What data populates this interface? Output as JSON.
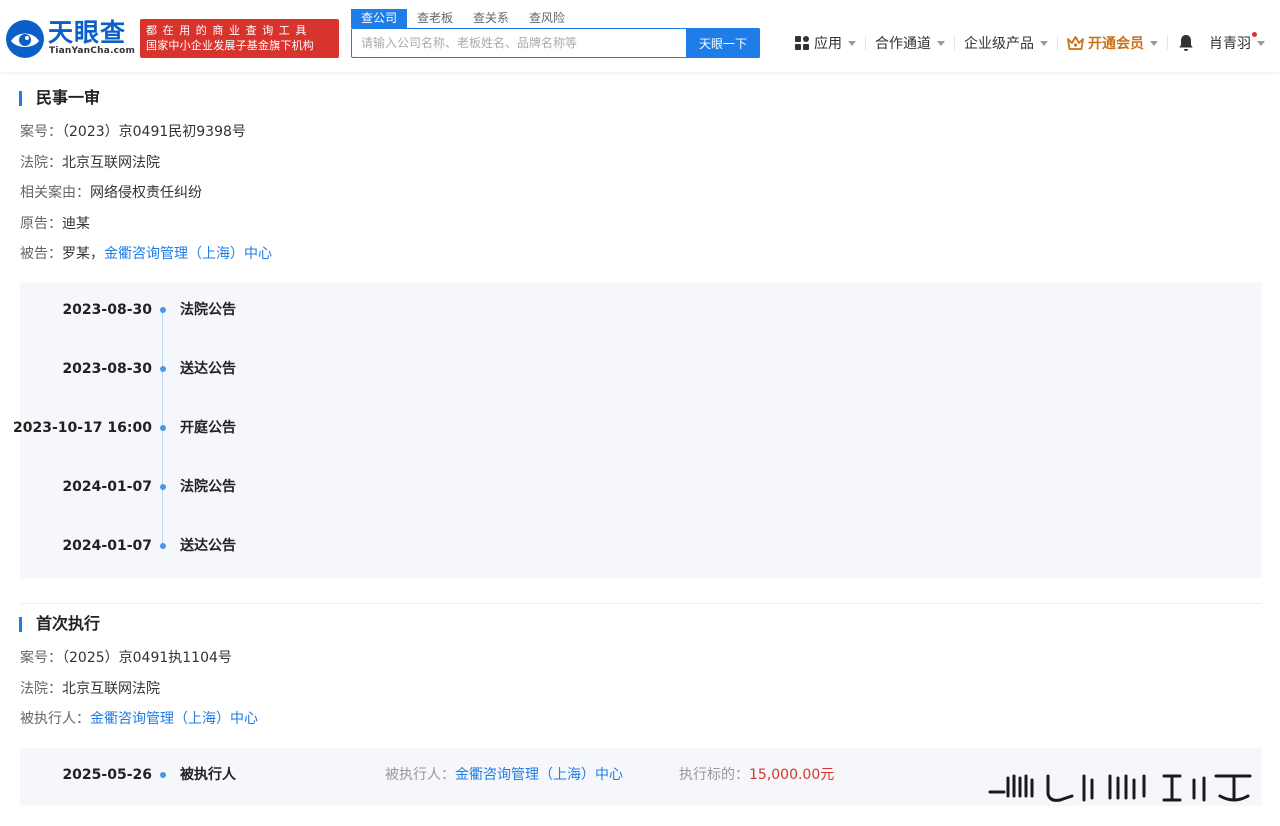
{
  "header": {
    "logo": {
      "name_cn": "天眼查",
      "name_en": "TianYanCha.com"
    },
    "slogan": {
      "line1": "都在用的商业查询工具",
      "line2": "国家中小企业发展子基金旗下机构"
    },
    "search": {
      "tabs": [
        "查公司",
        "查老板",
        "查关系",
        "查风险"
      ],
      "active_tab": 0,
      "placeholder": "请输入公司名称、老板姓名、品牌名称等",
      "button": "天眼一下"
    },
    "nav": {
      "apps": "应用",
      "partner": "合作通道",
      "enterprise": "企业级产品",
      "vip": "开通会员",
      "user": "肖青羽"
    }
  },
  "sections": [
    {
      "title": "民事一审",
      "fields": {
        "case_no_label": "案号：",
        "case_no": "（2023）京0491民初9398号",
        "court_label": "法院：",
        "court": "北京互联网法院",
        "cause_label": "相关案由：",
        "cause": "网络侵权责任纠纷",
        "plaintiff_label": "原告：",
        "plaintiff": "迪某",
        "defendant_label": "被告：",
        "defendant_person": "罗某，",
        "defendant_company": "金衢咨询管理（上海）中心"
      },
      "timeline": [
        {
          "date": "2023-08-30",
          "label": "法院公告"
        },
        {
          "date": "2023-08-30",
          "label": "送达公告"
        },
        {
          "date": "2023-10-17 16:00",
          "label": "开庭公告"
        },
        {
          "date": "2024-01-07",
          "label": "法院公告"
        },
        {
          "date": "2024-01-07",
          "label": "送达公告"
        }
      ]
    },
    {
      "title": "首次执行",
      "fields": {
        "case_no_label": "案号：",
        "case_no": "（2025）京0491执1104号",
        "court_label": "法院：",
        "court": "北京互联网法院",
        "executed_label": "被执行人：",
        "executed": "金衢咨询管理（上海）中心"
      },
      "timeline": [
        {
          "date": "2025-05-26",
          "label": "被执行人",
          "executed_label": "被执行人：",
          "executed": "金衢咨询管理（上海）中心",
          "amount_label": "执行标的：",
          "amount": "15,000.00元"
        }
      ]
    }
  ],
  "colors": {
    "brand": "#0a60c8",
    "accent": "#1e7de6",
    "slogan_bg": "#d9332e",
    "vip": "#c8731a",
    "money": "#d9332e"
  }
}
